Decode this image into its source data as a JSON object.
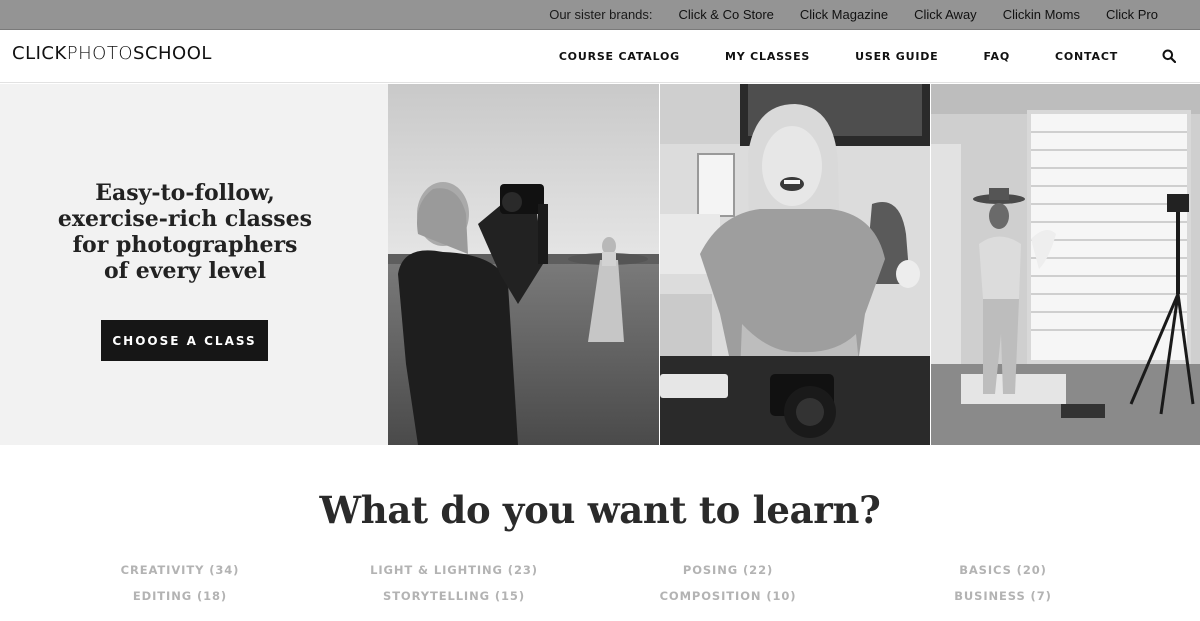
{
  "topbar": {
    "sister_label": "Our sister brands:",
    "brands": [
      "Click & Co Store",
      "Click Magazine",
      "Click Away",
      "Clickin Moms",
      "Click Pro"
    ]
  },
  "header": {
    "logo": {
      "part1": "CLICK",
      "part2": "PHOTO",
      "part3": "SCHOOL"
    },
    "nav": [
      "COURSE CATALOG",
      "MY CLASSES",
      "USER GUIDE",
      "FAQ",
      "CONTACT"
    ],
    "search_icon": "search-icon"
  },
  "hero": {
    "tagline_lines": [
      "Easy-to-follow,",
      "exercise-rich classes",
      "for photographers",
      "of every level"
    ],
    "cta_label": "CHOOSE A CLASS"
  },
  "learn": {
    "title": "What do you want to learn?",
    "categories": [
      [
        "CREATIVITY (34)",
        "LIGHT & LIGHTING (23)",
        "POSING (22)",
        "BASICS (20)"
      ],
      [
        "EDITING (18)",
        "STORYTELLING (15)",
        "COMPOSITION (10)",
        "BUSINESS (7)"
      ]
    ]
  },
  "colors": {
    "topbar_bg": "#949494",
    "cta_bg": "#161616",
    "hero_left_bg": "#f2f2f2",
    "category_text": "#b3b3b3"
  }
}
